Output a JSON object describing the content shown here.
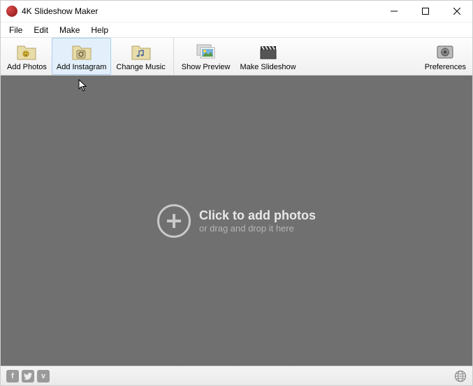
{
  "titlebar": {
    "title": "4K Slideshow Maker"
  },
  "menu": {
    "file": "File",
    "edit": "Edit",
    "make": "Make",
    "help": "Help"
  },
  "toolbar": {
    "addPhotos": "Add Photos",
    "addInstagram": "Add Instagram",
    "changeMusic": "Change Music",
    "showPreview": "Show Preview",
    "makeSlideshow": "Make Slideshow",
    "preferences": "Preferences"
  },
  "content": {
    "mainText": "Click to add photos",
    "subText": "or drag and drop it here"
  }
}
